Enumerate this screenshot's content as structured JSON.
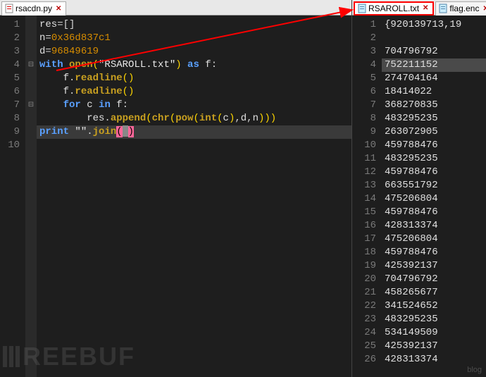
{
  "left": {
    "tab": {
      "label": "rsacdn.py",
      "icon": "file-python"
    },
    "lines": [
      1,
      2,
      3,
      4,
      5,
      6,
      7,
      8,
      9,
      10
    ],
    "code": {
      "l1": {
        "a": "res",
        "b": "=[]"
      },
      "l2": {
        "a": "n",
        "b": "=",
        "c": "0x36d837c1"
      },
      "l3": {
        "a": "d",
        "b": "=",
        "c": "96849619"
      },
      "l4": {
        "a": "with",
        "b": " open",
        "c": "(",
        "d": "\"RSAROLL.txt\"",
        "e": ")",
        "f": " as",
        "g": " f",
        "h": ":"
      },
      "l5": {
        "a": "    f",
        "b": ".",
        "c": "readline",
        "d": "()"
      },
      "l6": {
        "a": "    f",
        "b": ".",
        "c": "readline",
        "d": "()"
      },
      "l7": {
        "a": "    ",
        "b": "for",
        "c": " c ",
        "d": "in",
        "e": " f",
        "f": ":"
      },
      "l8": {
        "a": "        res",
        "b": ".",
        "c": "append",
        "d": "(",
        "e": "chr",
        "f": "(",
        "g": "pow",
        "h": "(",
        "i": "int",
        "j": "(",
        "k": "c",
        "l": ")",
        "m": ",",
        "n": "d",
        "o": ",",
        "p": "n",
        "q": ")))"
      },
      "l9": {
        "a": "print",
        "b": " \"\"",
        "c": ".",
        "d": "join",
        "e": "(",
        "f": ")"
      }
    }
  },
  "right": {
    "tabs": [
      {
        "label": "RSAROLL.txt",
        "icon": "file-txt",
        "highlighted": true
      },
      {
        "label": "flag.enc",
        "icon": "file-txt",
        "highlighted": false
      }
    ],
    "lines": [
      "{920139713,19",
      "",
      "704796792",
      "752211152",
      "274704164",
      "18414022",
      "368270835",
      "483295235",
      "263072905",
      "459788476",
      "483295235",
      "459788476",
      "663551792",
      "475206804",
      "459788476",
      "428313374",
      "475206804",
      "459788476",
      "425392137",
      "704796792",
      "458265677",
      "341524652",
      "483295235",
      "534149509",
      "425392137",
      "428313374"
    ]
  },
  "watermark": "REEBUF",
  "watermark_right": "blog"
}
